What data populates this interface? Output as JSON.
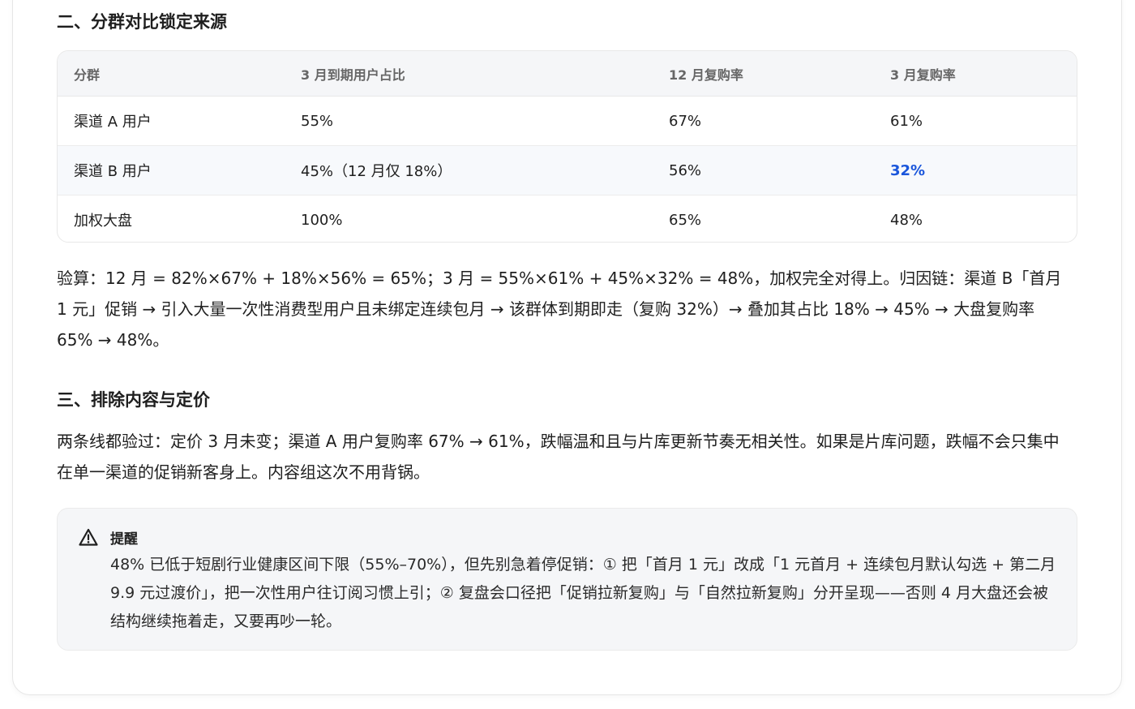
{
  "section2": {
    "title": "二、分群对比锁定来源",
    "table": {
      "headers": [
        "分群",
        "3 月到期用户占比",
        "12 月复购率",
        "3 月复购率"
      ],
      "rows": [
        [
          "渠道 A 用户",
          "55%",
          "67%",
          "61%"
        ],
        [
          "渠道 B 用户",
          "45%（12 月仅 18%）",
          "56%",
          "32%"
        ],
        [
          "加权大盘",
          "100%",
          "65%",
          "48%"
        ]
      ]
    },
    "paragraph": "验算：12 月 = 82%×67% + 18%×56% = 65%；3 月 = 55%×61% + 45%×32% = 48%，加权完全对得上。归因链：渠道 B「首月 1 元」促销 → 引入大量一次性消费型用户且未绑定连续包月 → 该群体到期即走（复购 32%）→ 叠加其占比 18% → 45% → 大盘复购率 65% → 48%。"
  },
  "section3": {
    "title": "三、排除内容与定价",
    "paragraph": "两条线都验过：定价 3 月未变；渠道 A 用户复购率 67% → 61%，跌幅温和且与片库更新节奏无相关性。如果是片库问题，跌幅不会只集中在单一渠道的促销新客身上。内容组这次不用背锅。"
  },
  "callout": {
    "icon": "warning-icon",
    "title": "提醒",
    "body": "48% 已低于短剧行业健康区间下限（55%–70%），但先别急着停促销：① 把「首月 1 元」改成「1 元首月 + 连续包月默认勾选 + 第二月 9.9 元过渡价」，把一次性用户往订阅习惯上引；② 复盘会口径把「促销拉新复购」与「自然拉新复购」分开呈现——否则 4 月大盘还会被结构继续拖着走，又要再吵一轮。"
  },
  "colors": {
    "highlight": "#1a56db"
  }
}
